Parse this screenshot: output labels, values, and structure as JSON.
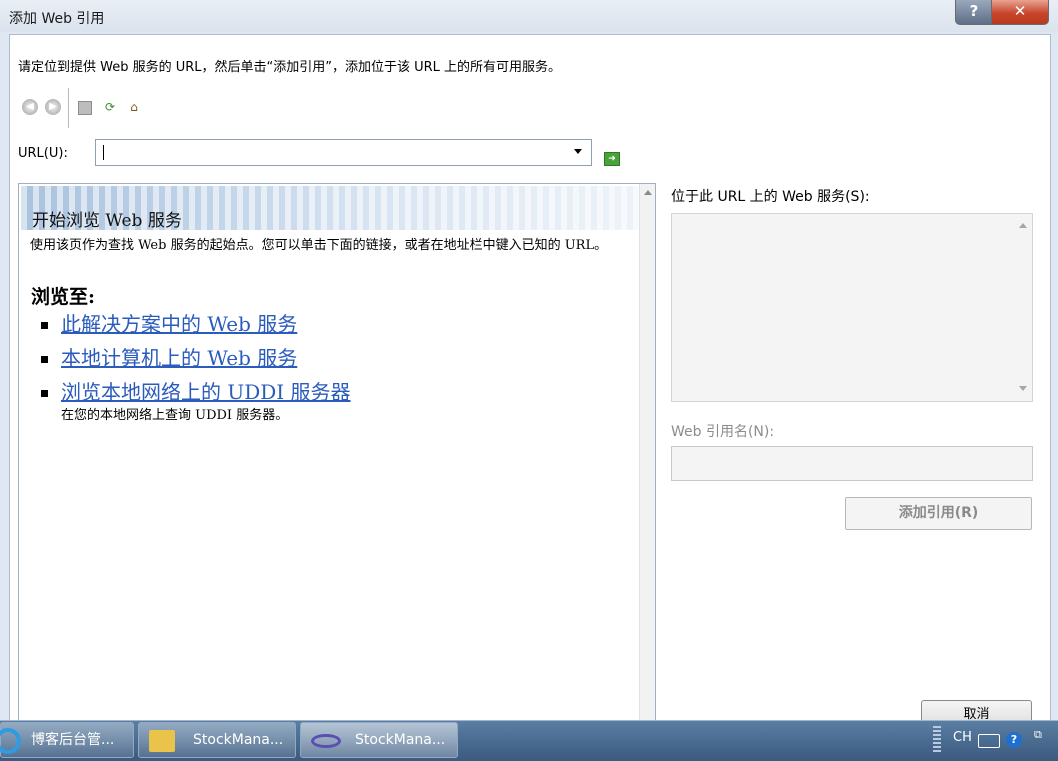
{
  "window": {
    "title": "添加 Web 引用",
    "help_label": "?",
    "close_label": "✕"
  },
  "instruction": "请定位到提供 Web 服务的 URL，然后单击“添加引用”，添加位于该 URL 上的所有可用服务。",
  "toolbar": {
    "icons": [
      "back-arrow-icon",
      "forward-arrow-icon",
      "stop-icon",
      "refresh-icon",
      "home-icon"
    ]
  },
  "url": {
    "label": "URL(U):",
    "value": ""
  },
  "browser": {
    "banner_title": "开始浏览 Web 服务",
    "description": "使用该页作为查找 Web 服务的起始点。您可以单击下面的链接，或者在地址栏中键入已知的 URL。",
    "browse_heading": "浏览至:",
    "links": [
      {
        "label": "此解决方案中的 Web 服务"
      },
      {
        "label": "本地计算机上的 Web 服务"
      },
      {
        "label": "浏览本地网络上的 UDDI 服务器",
        "sub": "在您的本地网络上查询 UDDI 服务器。"
      }
    ]
  },
  "services": {
    "label": "位于此 URL 上的 Web 服务(S):"
  },
  "reference": {
    "label": "Web 引用名(N):",
    "value": "",
    "add_button": "添加引用(R)",
    "cancel_button": "取消"
  },
  "taskbar": {
    "tasks": [
      {
        "label": "博客后台管...",
        "icon": "ie-icon"
      },
      {
        "label": "StockMana...",
        "icon": "folder-icon"
      },
      {
        "label": "StockMana...",
        "icon": "visual-studio-icon"
      }
    ],
    "tray": {
      "language": "CH"
    }
  }
}
